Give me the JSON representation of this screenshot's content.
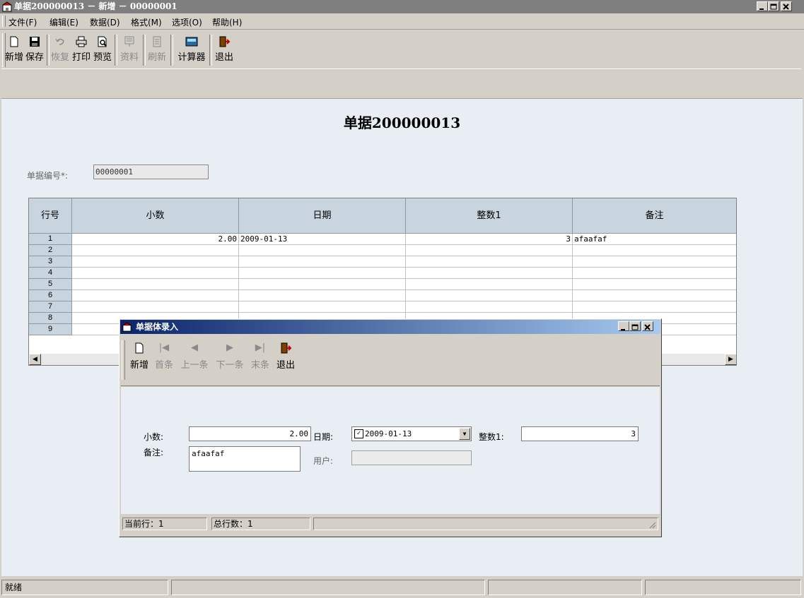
{
  "window": {
    "title": "单据200000013 － 新增 － 00000001"
  },
  "menu": [
    "文件(F)",
    "编辑(E)",
    "数据(D)",
    "格式(M)",
    "选项(O)",
    "帮助(H)"
  ],
  "toolbar": [
    {
      "label": "新增",
      "icon": "new-doc-icon",
      "enabled": true
    },
    {
      "label": "保存",
      "icon": "save-disk-icon",
      "enabled": true
    },
    {
      "label": "恢复",
      "icon": "undo-icon",
      "enabled": false
    },
    {
      "label": "打印",
      "icon": "printer-icon",
      "enabled": true
    },
    {
      "label": "预览",
      "icon": "preview-icon",
      "enabled": true
    },
    {
      "label": "资料",
      "icon": "info-icon",
      "enabled": false
    },
    {
      "label": "刷新",
      "icon": "refresh-icon",
      "enabled": false
    },
    {
      "label": "计算器",
      "icon": "calculator-icon",
      "enabled": true
    },
    {
      "label": "退出",
      "icon": "exit-door-icon",
      "enabled": true
    }
  ],
  "document": {
    "title": "单据200000013",
    "number_label": "单据编号*:",
    "number_value": "00000001"
  },
  "grid": {
    "columns": [
      "行号",
      "小数",
      "日期",
      "整数1",
      "备注"
    ],
    "rows": [
      [
        "1",
        "2.00",
        "2009-01-13",
        "3",
        "afaafaf"
      ],
      [
        "2",
        "",
        "",
        "",
        ""
      ],
      [
        "3",
        "",
        "",
        "",
        ""
      ],
      [
        "4",
        "",
        "",
        "",
        ""
      ],
      [
        "5",
        "",
        "",
        "",
        ""
      ],
      [
        "6",
        "",
        "",
        "",
        ""
      ],
      [
        "7",
        "",
        "",
        "",
        ""
      ],
      [
        "8",
        "",
        "",
        "",
        ""
      ],
      [
        "9",
        "",
        "",
        "",
        ""
      ]
    ]
  },
  "dialog": {
    "title": "单据体录入",
    "toolbar": [
      {
        "label": "新增",
        "icon": "new-doc-icon",
        "enabled": true
      },
      {
        "label": "首条",
        "icon": "first-record-icon",
        "enabled": false
      },
      {
        "label": "上一条",
        "icon": "prev-record-icon",
        "enabled": false
      },
      {
        "label": "下一条",
        "icon": "next-record-icon",
        "enabled": false
      },
      {
        "label": "末条",
        "icon": "last-record-icon",
        "enabled": false
      },
      {
        "label": "退出",
        "icon": "exit-door-icon",
        "enabled": true
      }
    ],
    "fields": {
      "decimal_label": "小数:",
      "decimal_value": "2.00",
      "date_label": "日期:",
      "date_value": "2009-01-13",
      "int_label": "整数1:",
      "int_value": "3",
      "note_label": "备注:",
      "note_value": "afaafaf",
      "user_label": "用户:",
      "user_value": ""
    },
    "status": {
      "current_row": "当前行：1",
      "total_rows": "总行数：1"
    }
  },
  "statusbar": {
    "text": "就绪"
  }
}
